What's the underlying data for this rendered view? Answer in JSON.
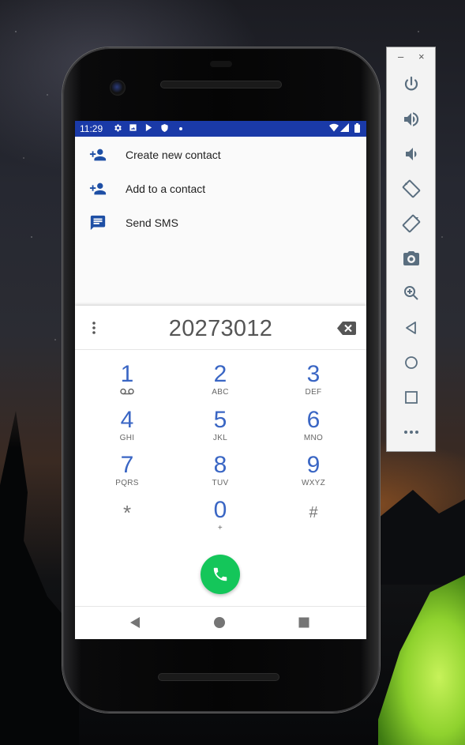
{
  "status_bar": {
    "time": "11:29",
    "icons": [
      "gear-icon",
      "image-icon",
      "play-store-icon",
      "shield-icon",
      "dot-icon",
      "wifi-icon",
      "signal-icon",
      "battery-icon"
    ]
  },
  "suggestions": [
    {
      "label": "Create new contact",
      "icon": "add-person-icon"
    },
    {
      "label": "Add to a contact",
      "icon": "add-person-icon"
    },
    {
      "label": "Send SMS",
      "icon": "message-icon"
    }
  ],
  "dialpad": {
    "number": "20273012",
    "keys": [
      {
        "num": "1",
        "letters": ""
      },
      {
        "num": "2",
        "letters": "ABC"
      },
      {
        "num": "3",
        "letters": "DEF"
      },
      {
        "num": "4",
        "letters": "GHI"
      },
      {
        "num": "5",
        "letters": "JKL"
      },
      {
        "num": "6",
        "letters": "MNO"
      },
      {
        "num": "7",
        "letters": "PQRS"
      },
      {
        "num": "8",
        "letters": "TUV"
      },
      {
        "num": "9",
        "letters": "WXYZ"
      },
      {
        "num": "*",
        "letters": ""
      },
      {
        "num": "0",
        "letters": "+"
      },
      {
        "num": "#",
        "letters": ""
      }
    ]
  },
  "emulator": {
    "minimize": "–",
    "close": "×",
    "buttons": [
      "power-icon",
      "volume-up-icon",
      "volume-down-icon",
      "rotate-left-icon",
      "rotate-right-icon",
      "camera-icon",
      "zoom-icon",
      "back-icon",
      "home-icon",
      "overview-icon",
      "more-icon"
    ]
  },
  "colors": {
    "status_bar": "#1a3aa8",
    "accent": "#3a66c4",
    "call": "#14c65a"
  }
}
